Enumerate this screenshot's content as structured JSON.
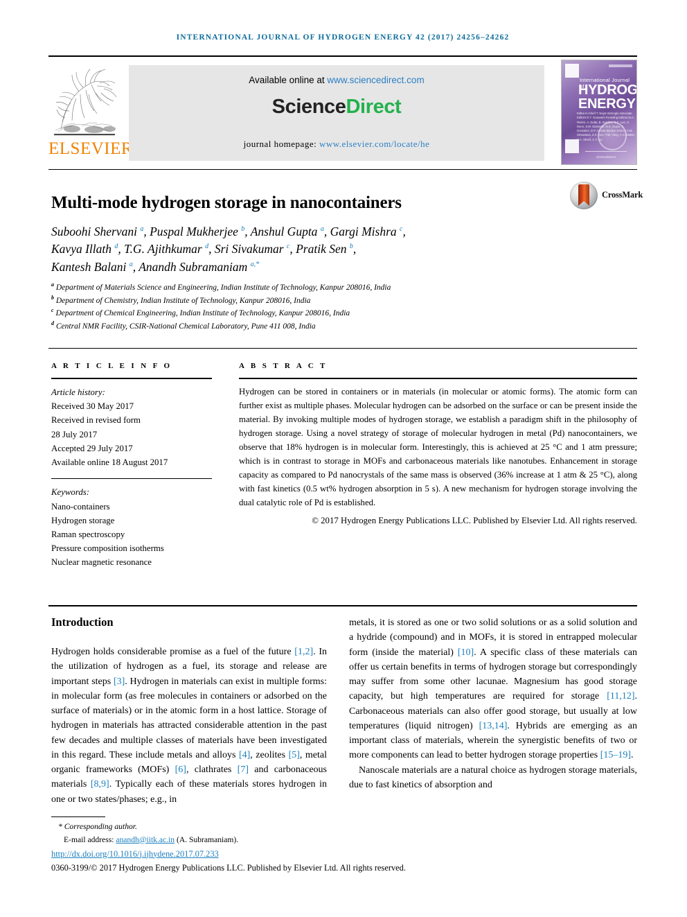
{
  "running_head": "INTERNATIONAL JOURNAL OF HYDROGEN ENERGY 42 (2017) 24256–24262",
  "masthead": {
    "publisher_name": "ELSEVIER",
    "available_prefix": "Available online at ",
    "available_url": "www.sciencedirect.com",
    "brand_first": "Science",
    "brand_second": "Direct",
    "homepage_prefix": "journal homepage: ",
    "homepage_url": "www.elsevier.com/locate/he",
    "cover": {
      "kicker": "International Journal of",
      "line1": "HYDROGEN",
      "line2": "ENERGY",
      "editors": "Editor-in-Chief   T. Nejat Veziroglu\nAssociate Editors   D.Y. Goswami\nFounding Editors   M.A. Rosen, A. Dutta,\nB. Sunden, S.C. Lee, S. Dunn,\nS.M. Giannetti, M.S. Gupta,\nA. Gonzalez, D.P. Acosta\nSection Editors   C.M. Srivastava, Z.X. Guo,\nY.W. Yang, A.G. Mattei,\nS.A. Sherif, C.Y. Liu",
      "footer": "ScienceDirect"
    }
  },
  "article": {
    "title": "Multi-mode hydrogen storage in nanocontainers",
    "crossmark_label": "CrossMark",
    "authors_lines": [
      {
        "parts": [
          {
            "text": "Suboohi Shervani ",
            "sup": "a"
          },
          {
            "text": ", Puspal Mukherjee ",
            "sup": "b"
          },
          {
            "text": ", Anshul Gupta ",
            "sup": "a"
          },
          {
            "text": ", Gargi Mishra ",
            "sup": "c"
          },
          {
            "text": ",",
            "sup": ""
          }
        ]
      },
      {
        "parts": [
          {
            "text": "Kavya Illath ",
            "sup": "d"
          },
          {
            "text": ", T.G. Ajithkumar ",
            "sup": "d"
          },
          {
            "text": ", Sri Sivakumar ",
            "sup": "c"
          },
          {
            "text": ", Pratik Sen ",
            "sup": "b"
          },
          {
            "text": ",",
            "sup": ""
          }
        ]
      },
      {
        "parts": [
          {
            "text": "Kantesh Balani ",
            "sup": "a"
          },
          {
            "text": ", Anandh Subramaniam ",
            "sup": "a,*"
          }
        ]
      }
    ],
    "affiliations": [
      {
        "mark": "a",
        "text": "Department of Materials Science and Engineering, Indian Institute of Technology, Kanpur 208016, India"
      },
      {
        "mark": "b",
        "text": "Department of Chemistry, Indian Institute of Technology, Kanpur 208016, India"
      },
      {
        "mark": "c",
        "text": "Department of Chemical Engineering, Indian Institute of Technology, Kanpur 208016, India"
      },
      {
        "mark": "d",
        "text": "Central NMR Facility, CSIR-National Chemical Laboratory, Pune 411 008, India"
      }
    ]
  },
  "article_info": {
    "heading": "A R T I C L E   I N F O",
    "history_label": "Article history:",
    "history": [
      "Received 30 May 2017",
      "Received in revised form",
      "28 July 2017",
      "Accepted 29 July 2017",
      "Available online 18 August 2017"
    ],
    "keywords_label": "Keywords:",
    "keywords": [
      "Nano-containers",
      "Hydrogen storage",
      "Raman spectroscopy",
      "Pressure composition isotherms",
      "Nuclear magnetic resonance"
    ]
  },
  "abstract": {
    "heading": "A B S T R A C T",
    "body": "Hydrogen can be stored in containers or in materials (in molecular or atomic forms). The atomic form can further exist as multiple phases. Molecular hydrogen can be adsorbed on the surface or can be present inside the material. By invoking multiple modes of hydrogen storage, we establish a paradigm shift in the philosophy of hydrogen storage. Using a novel strategy of storage of molecular hydrogen in metal (Pd) nanocontainers, we observe that 18% hydrogen is in molecular form. Interestingly, this is achieved at 25 °C and 1 atm pressure; which is in contrast to storage in MOFs and carbonaceous materials like nanotubes. Enhancement in storage capacity as compared to Pd nanocrystals of the same mass is observed (36% increase at 1 atm & 25 °C), along with fast kinetics (0.5 wt% hydrogen absorption in 5 s). A new mechanism for hydrogen storage involving the dual catalytic role of Pd is established.",
    "copyright": "© 2017 Hydrogen Energy Publications LLC. Published by Elsevier Ltd. All rights reserved."
  },
  "body": {
    "intro_heading": "Introduction",
    "left_paragraph": "Hydrogen holds considerable promise as a fuel of the future [1,2]. In the utilization of hydrogen as a fuel, its storage and release are important steps [3]. Hydrogen in materials can exist in multiple forms: in molecular form (as free molecules in containers or adsorbed on the surface of materials) or in the atomic form in a host lattice. Storage of hydrogen in materials has attracted considerable attention in the past few decades and multiple classes of materials have been investigated in this regard. These include metals and alloys [4], zeolites [5], metal organic frameworks (MOFs) [6], clathrates [7] and carbonaceous materials [8,9]. Typically each of these materials stores hydrogen in one or two states/phases; e.g., in",
    "right_paragraph_1": "metals, it is stored as one or two solid solutions or as a solid solution and a hydride (compound) and in MOFs, it is stored in entrapped molecular form (inside the material) [10]. A specific class of these materials can offer us certain benefits in terms of hydrogen storage but correspondingly may suffer from some other lacunae. Magnesium has good storage capacity, but high temperatures are required for storage [11,12]. Carbonaceous materials can also offer good storage, but usually at low temperatures (liquid nitrogen) [13,14]. Hybrids are emerging as an important class of materials, wherein the synergistic benefits of two or more components can lead to better hydrogen storage properties [15–19].",
    "right_paragraph_2": "Nanoscale materials are a natural choice as hydrogen storage materials, due to fast kinetics of absorption and"
  },
  "footer": {
    "corresponding": "* Corresponding author.",
    "email_label": "E-mail address: ",
    "email": "anandh@iitk.ac.in",
    "email_suffix": " (A. Subramaniam).",
    "doi": "http://dx.doi.org/10.1016/j.ijhydene.2017.07.233",
    "issn_line": "0360-3199/© 2017 Hydrogen Energy Publications LLC. Published by Elsevier Ltd. All rights reserved."
  },
  "colors": {
    "link": "#1b7fbd",
    "running_head": "#0b6c9b",
    "elsevier_orange": "#ef8200",
    "sciencedirect_green": "#23b14d"
  }
}
